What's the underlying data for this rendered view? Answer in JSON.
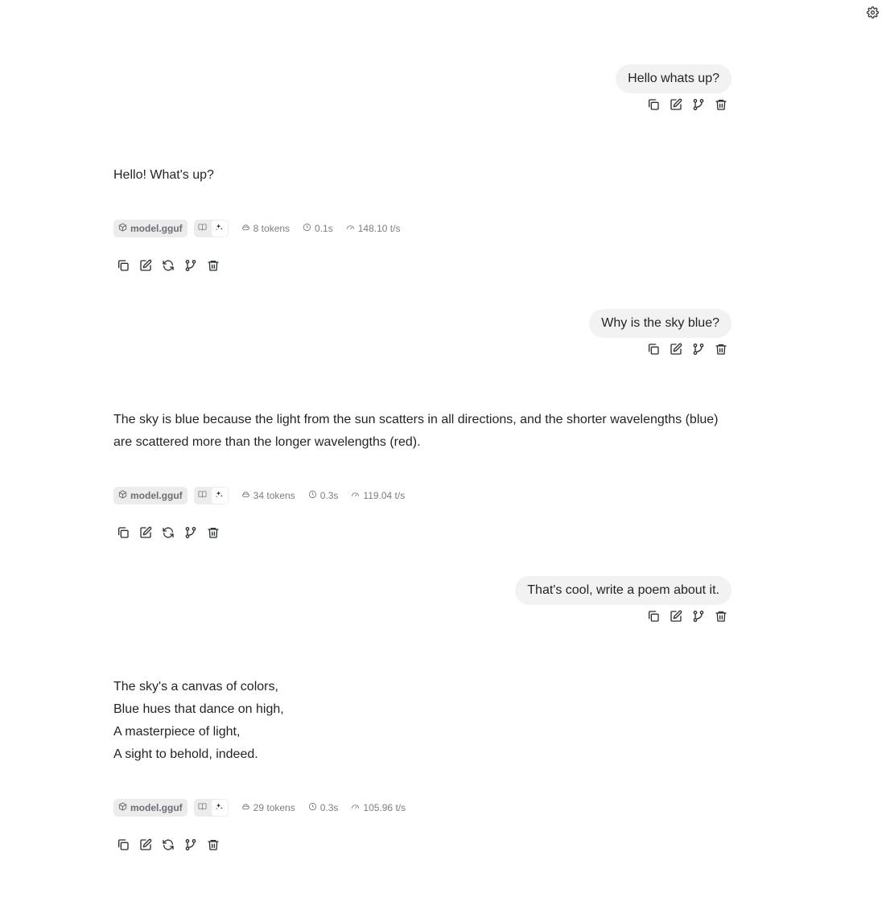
{
  "settings": {
    "icon": "gear-icon"
  },
  "messages": [
    {
      "role": "user",
      "text": "Hello whats up?"
    },
    {
      "role": "assistant",
      "lines": [
        "Hello! What's up?"
      ],
      "model": "model.gguf",
      "tokens": "8 tokens",
      "time": "0.1s",
      "speed": "148.10 t/s"
    },
    {
      "role": "user",
      "text": "Why is the sky blue?"
    },
    {
      "role": "assistant",
      "lines": [
        "The sky is blue because the light from the sun scatters in all directions, and the shorter wavelengths (blue) are scattered more than the longer wavelengths (red)."
      ],
      "model": "model.gguf",
      "tokens": "34 tokens",
      "time": "0.3s",
      "speed": "119.04 t/s"
    },
    {
      "role": "user",
      "text": "That's cool, write a poem about it."
    },
    {
      "role": "assistant",
      "lines": [
        "The sky's a canvas of colors,",
        "Blue hues that dance on high,",
        "A masterpiece of light,",
        "A sight to behold, indeed."
      ],
      "model": "model.gguf",
      "tokens": "29 tokens",
      "time": "0.3s",
      "speed": "105.96 t/s"
    }
  ]
}
